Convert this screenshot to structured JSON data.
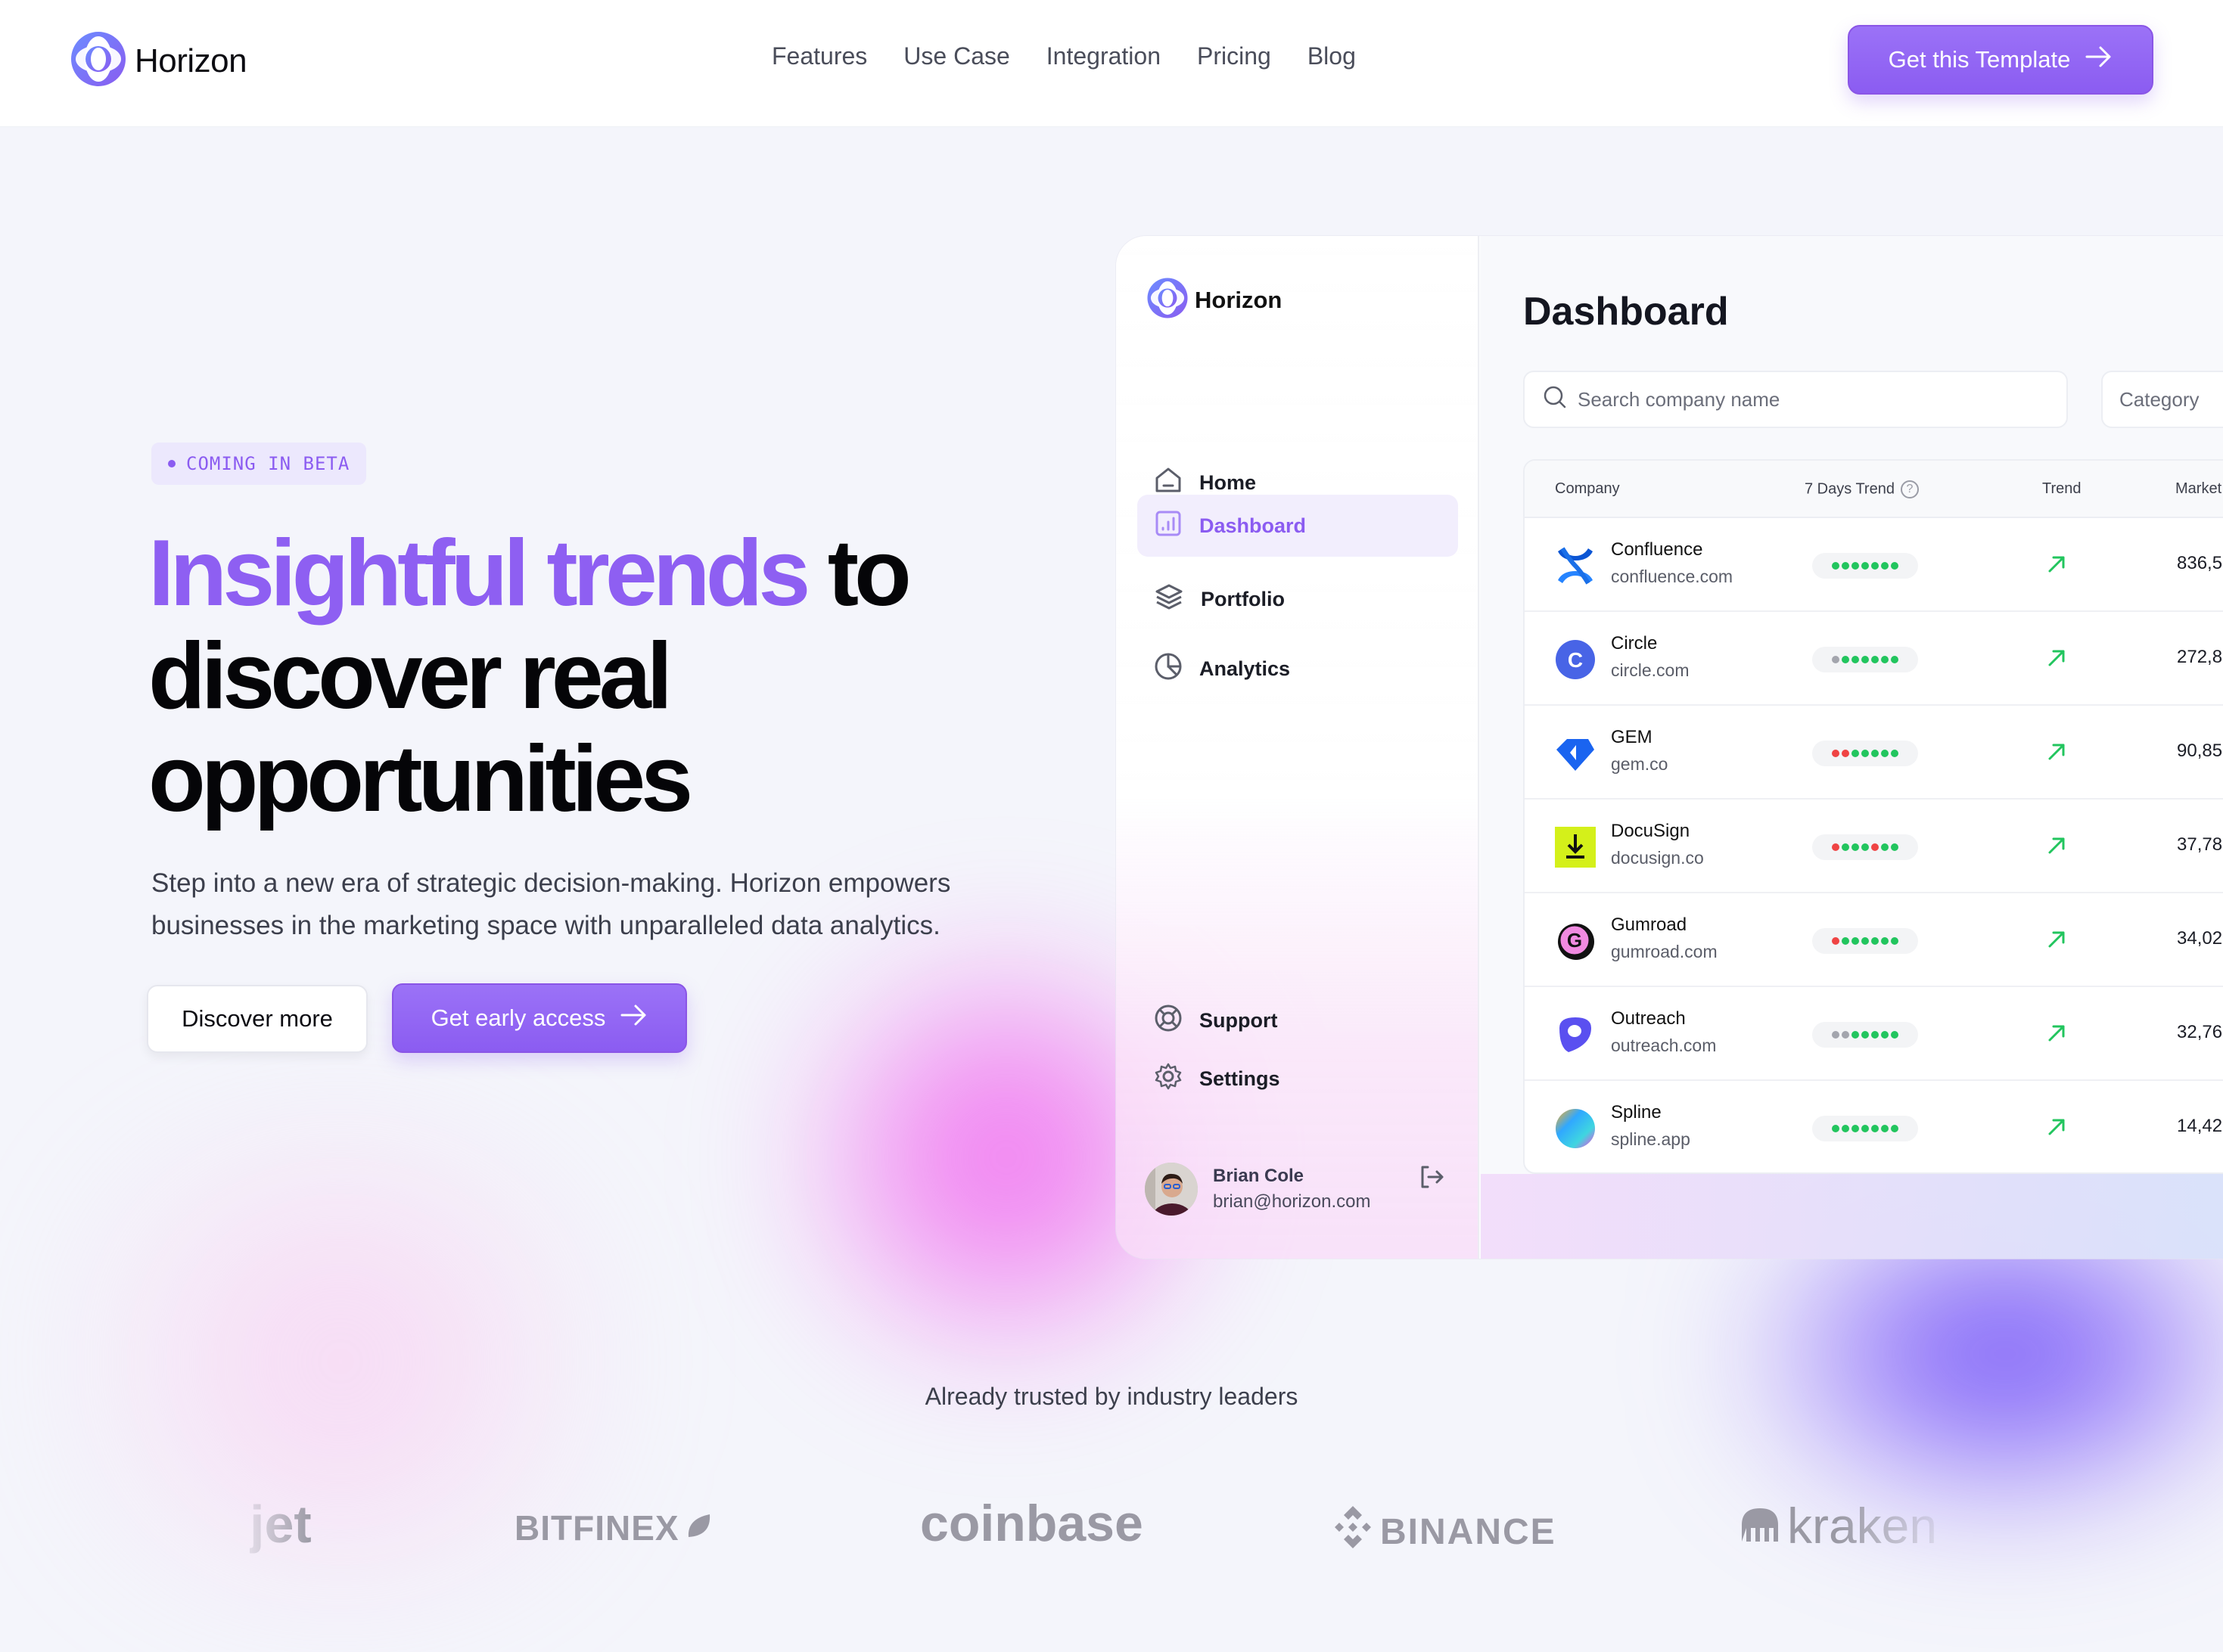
{
  "header": {
    "brand": "Horizon",
    "nav": [
      "Features",
      "Use Case",
      "Integration",
      "Pricing",
      "Blog"
    ],
    "cta_label": "Get this Template"
  },
  "hero": {
    "badge": "COMING IN BETA",
    "headline_accent": "Insightful trends",
    "headline_rest_1": " to",
    "headline_line_2": "discover real",
    "headline_line_3": "opportunities",
    "subtext": "Step into a new era of strategic decision-making. Horizon empowers businesses in the marketing space with unparalleled data analytics.",
    "secondary_button": "Discover more",
    "primary_button": "Get early access"
  },
  "mockup": {
    "brand": "Horizon",
    "sidebar": {
      "items": [
        {
          "label": "Home",
          "icon": "home-icon",
          "active": false
        },
        {
          "label": "Dashboard",
          "icon": "chart-icon",
          "active": true
        },
        {
          "label": "Portfolio",
          "icon": "layers-icon",
          "active": false
        },
        {
          "label": "Analytics",
          "icon": "pie-chart-icon",
          "active": false
        }
      ],
      "bottom_items": [
        {
          "label": "Support",
          "icon": "lifebuoy-icon"
        },
        {
          "label": "Settings",
          "icon": "gear-icon"
        }
      ],
      "user": {
        "name": "Brian Cole",
        "email": "brian@horizon.com"
      }
    },
    "title": "Dashboard",
    "search_placeholder": "Search company name",
    "category_label": "Category",
    "table": {
      "columns": [
        "Company",
        "7 Days Trend",
        "Trend",
        "Market"
      ],
      "rows": [
        {
          "name": "Confluence",
          "domain": "confluence.com",
          "dots": [
            "g",
            "g",
            "g",
            "g",
            "g",
            "g",
            "g"
          ],
          "market": "836,5"
        },
        {
          "name": "Circle",
          "domain": "circle.com",
          "dots": [
            "n",
            "g",
            "g",
            "g",
            "g",
            "g",
            "g"
          ],
          "market": "272,8"
        },
        {
          "name": "GEM",
          "domain": "gem.co",
          "dots": [
            "r",
            "r",
            "g",
            "g",
            "g",
            "g",
            "g"
          ],
          "market": "90,85"
        },
        {
          "name": "DocuSign",
          "domain": "docusign.co",
          "dots": [
            "r",
            "g",
            "g",
            "g",
            "r",
            "g",
            "g"
          ],
          "market": "37,78"
        },
        {
          "name": "Gumroad",
          "domain": "gumroad.com",
          "dots": [
            "r",
            "g",
            "g",
            "g",
            "g",
            "g",
            "g"
          ],
          "market": "34,02"
        },
        {
          "name": "Outreach",
          "domain": "outreach.com",
          "dots": [
            "n",
            "n",
            "g",
            "g",
            "g",
            "g",
            "g"
          ],
          "market": "32,76"
        },
        {
          "name": "Spline",
          "domain": "spline.app",
          "dots": [
            "g",
            "g",
            "g",
            "g",
            "g",
            "g",
            "g"
          ],
          "market": "14,42"
        }
      ]
    }
  },
  "trusted": {
    "label": "Already trusted by industry leaders",
    "logos": [
      "jet",
      "BITFINEX",
      "coinbase",
      "BINANCE",
      "kraken"
    ]
  },
  "colors": {
    "accent": "#8b5cf1",
    "green": "#22c55e",
    "red": "#ef4444",
    "neutral_dot": "#a3a5ad"
  }
}
